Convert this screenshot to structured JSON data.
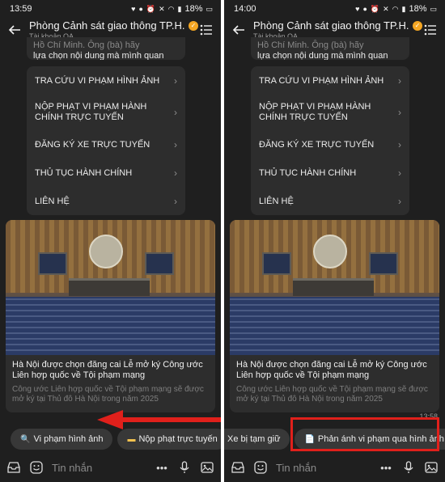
{
  "screens": [
    {
      "status": {
        "time": "13:59",
        "battery": "18%"
      },
      "header": {
        "title": "Phòng Cảnh sát giao thông TP.H...",
        "subtitle": "Tài khoản OA"
      },
      "message": {
        "line1": "Hồ Chí Minh. Ông (bà) hãy",
        "line2": "lựa chọn nội dung mà mình quan tâm:"
      },
      "menu": [
        {
          "label": "TRA CỨU VI PHẠM HÌNH ẢNH"
        },
        {
          "label": "NỘP PHẠT VI PHẠM HÀNH CHÍNH TRỰC TUYẾN"
        },
        {
          "label": "ĐĂNG KÝ XE TRỰC TUYẾN"
        },
        {
          "label": "THỦ TỤC HÀNH CHÍNH"
        },
        {
          "label": "LIÊN HỆ"
        }
      ],
      "news": {
        "title": "Hà Nội được chọn đăng cai Lễ mở ký Công ước Liên hợp quốc về Tội phạm mạng",
        "description": "Công ước Liên hợp quốc về Tội phạm mạng sẽ được mở ký tại Thủ đô Hà Nội trong năm 2025"
      },
      "chips": [
        {
          "label": "Vi phạm hình ảnh",
          "icon": "search-bubble-icon"
        },
        {
          "label": "Nộp phạt trực tuyến",
          "icon": "card-icon"
        }
      ],
      "input": {
        "placeholder": "Tin nhắn"
      }
    },
    {
      "status": {
        "time": "14:00",
        "battery": "18%"
      },
      "header": {
        "title": "Phòng Cảnh sát giao thông TP.H...",
        "subtitle": "Tài khoản OA"
      },
      "message": {
        "line1": "Hồ Chí Minh. Ông (bà) hãy",
        "line2": "lựa chọn nội dung mà mình quan tâm:"
      },
      "menu": [
        {
          "label": "TRA CỨU VI PHẠM HÌNH ẢNH"
        },
        {
          "label": "NỘP PHẠT VI PHẠM HÀNH CHÍNH TRỰC TUYẾN"
        },
        {
          "label": "ĐĂNG KÝ XE TRỰC TUYẾN"
        },
        {
          "label": "THỦ TỤC HÀNH CHÍNH"
        },
        {
          "label": "LIÊN HỆ"
        }
      ],
      "news": {
        "title": "Hà Nội được chọn đăng cai Lễ mở ký Công ước Liên hợp quốc về Tội phạm mạng",
        "description": "Công ước Liên hợp quốc về Tội phạm mạng sẽ được mở ký tại Thủ đô Hà Nội trong năm 2025"
      },
      "timestamp": "13:58",
      "chips": [
        {
          "label": "Xe bị tạm giữ"
        },
        {
          "label": "Phản ánh vi phạm qua hình ảnh",
          "icon": "document-icon"
        }
      ],
      "input": {
        "placeholder": "Tin nhắn"
      }
    }
  ],
  "colors": {
    "background": "#1f1f1f",
    "bubble": "#2d2d2d",
    "chip": "#383838",
    "highlight": "#e0201b",
    "verified": "#f4a623"
  }
}
